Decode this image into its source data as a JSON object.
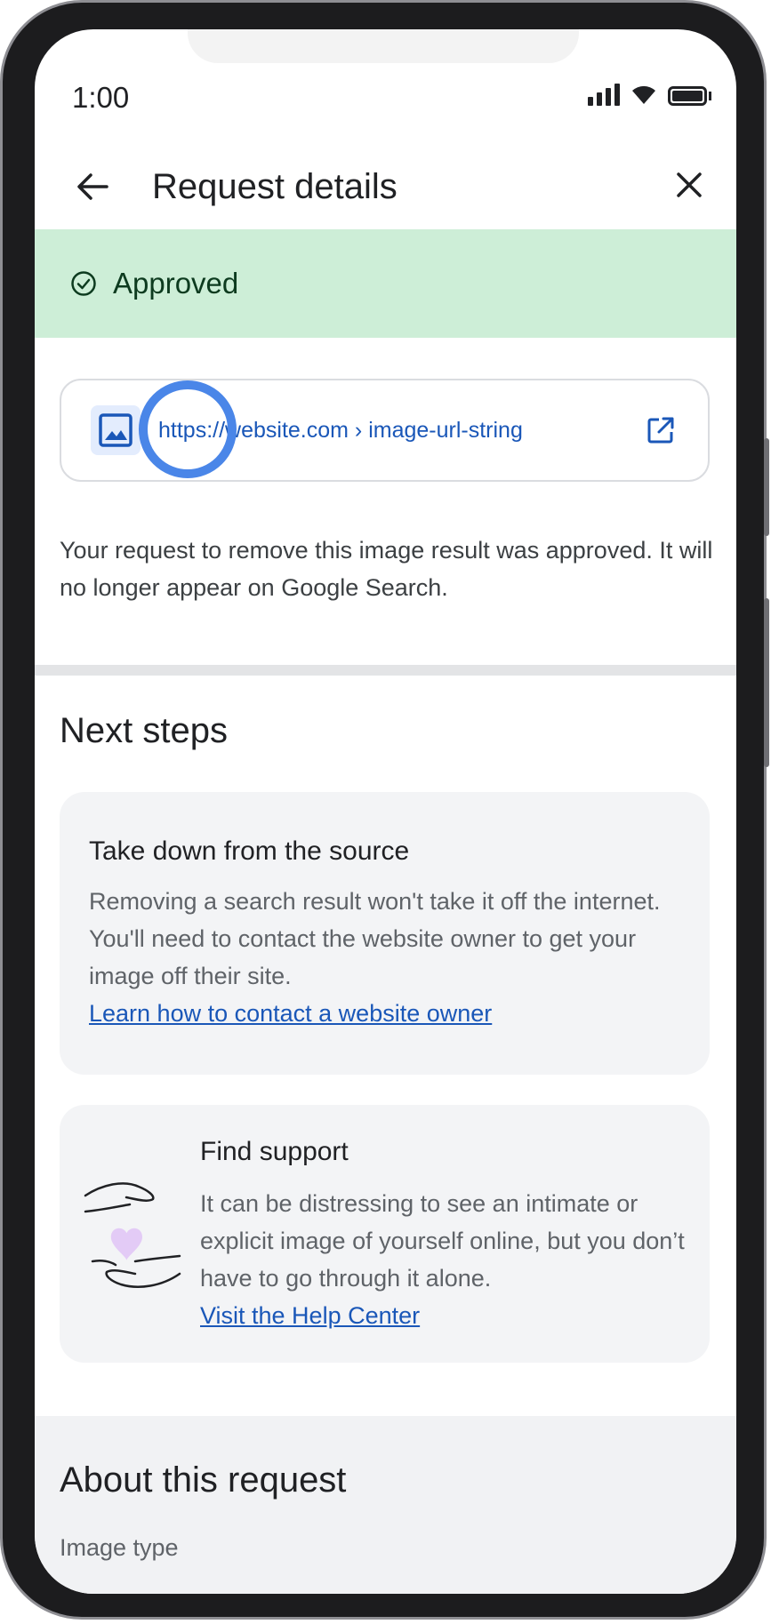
{
  "status_bar": {
    "time": "1:00"
  },
  "header": {
    "title": "Request details"
  },
  "banner": {
    "status": "Approved",
    "background": "#cdeed7"
  },
  "url_card": {
    "url": "https://website.com › image-url-string"
  },
  "description": "Your request to remove this image result was approved. It will no longer appear on Google Search.",
  "next_steps": {
    "heading": "Next steps",
    "cards": [
      {
        "title": "Take down from the source",
        "body": "Removing a search result won't take it off the internet. You'll need to contact the website owner to get your image off their site.",
        "link": "Learn how to contact a website owner"
      },
      {
        "title": "Find support",
        "body": "It can be distressing to see an intimate or explicit image of yourself online, but you don’t have to go through it alone.",
        "link": "Visit the Help Center"
      }
    ]
  },
  "about": {
    "heading": "About this request",
    "subtext": "Image type"
  },
  "colors": {
    "link": "#1a57b8",
    "highlight_ring": "#4a86e8",
    "heart": "#e3cbf6"
  }
}
